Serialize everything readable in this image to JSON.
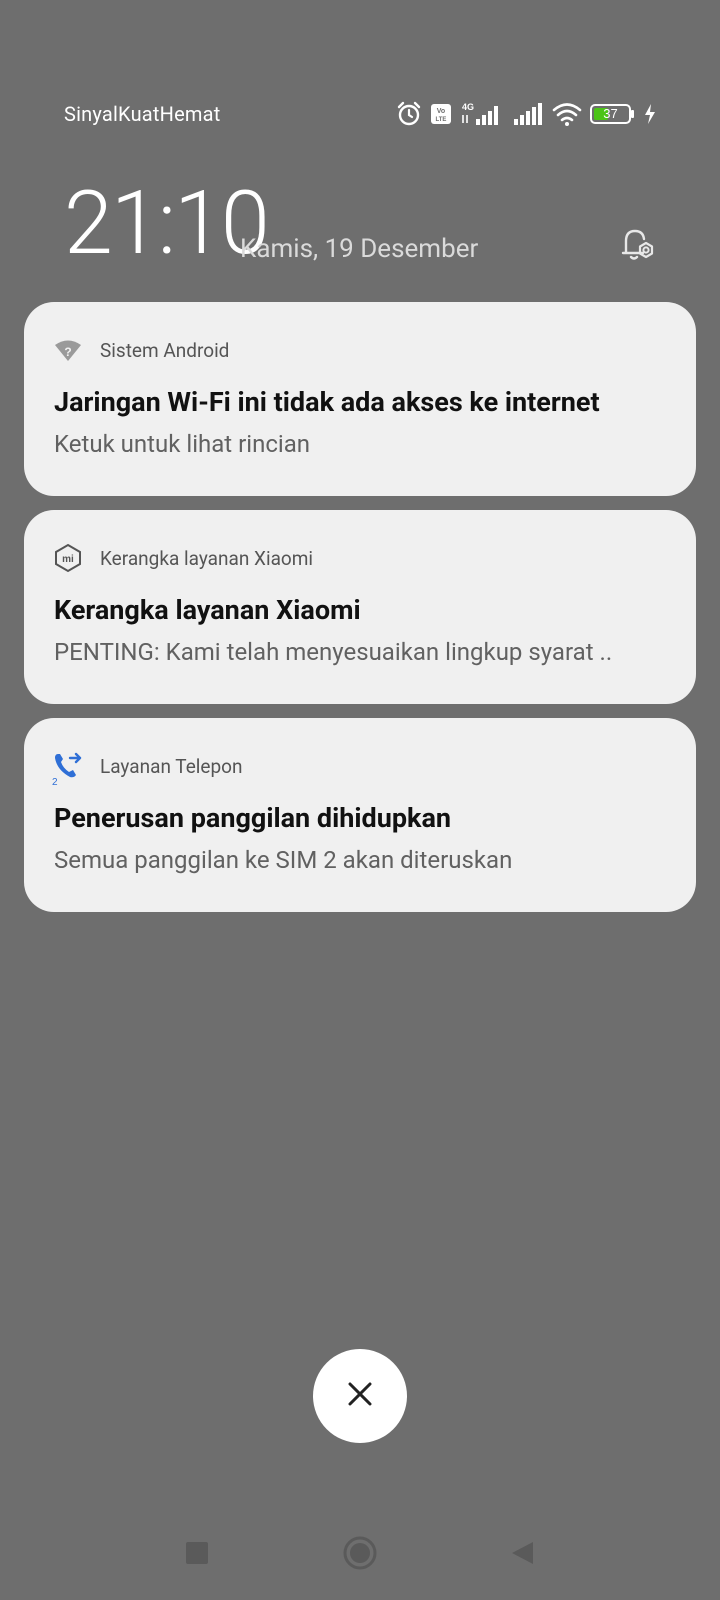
{
  "status_bar": {
    "carrier": "SinyalKuatHemat",
    "battery": "37",
    "network_type": "4G",
    "volte": "Vo LTE",
    "icons": [
      "alarm-icon",
      "volte-icon",
      "signal-4g-icon",
      "signal-icon",
      "wifi-icon",
      "battery-icon",
      "charging-icon"
    ]
  },
  "lockscreen": {
    "time": "21:10",
    "date": "Kamis, 19 Desember"
  },
  "notifications": [
    {
      "app": "Sistem Android",
      "icon": "wifi-question-icon",
      "title": "Jaringan Wi-Fi ini tidak ada akses ke internet",
      "body": "Ketuk untuk lihat rincian"
    },
    {
      "app": "Kerangka layanan Xiaomi",
      "icon": "mi-logo-icon",
      "title": "Kerangka layanan Xiaomi",
      "body": "PENTING: Kami telah menyesuaikan lingkup syarat .."
    },
    {
      "app": "Layanan Telepon",
      "icon": "call-forward-icon",
      "icon_badge": "2",
      "title": "Penerusan panggilan dihidupkan",
      "body": "Semua panggilan ke SIM 2 akan diteruskan"
    }
  ],
  "controls": {
    "dismiss_icon": "close-icon",
    "nav": [
      "recents-icon",
      "home-icon",
      "back-icon"
    ]
  },
  "colors": {
    "background": "#6e6e6e",
    "card": "#f0f0f0",
    "accent_blue": "#2f6fd6",
    "battery_green": "#4cc417"
  }
}
